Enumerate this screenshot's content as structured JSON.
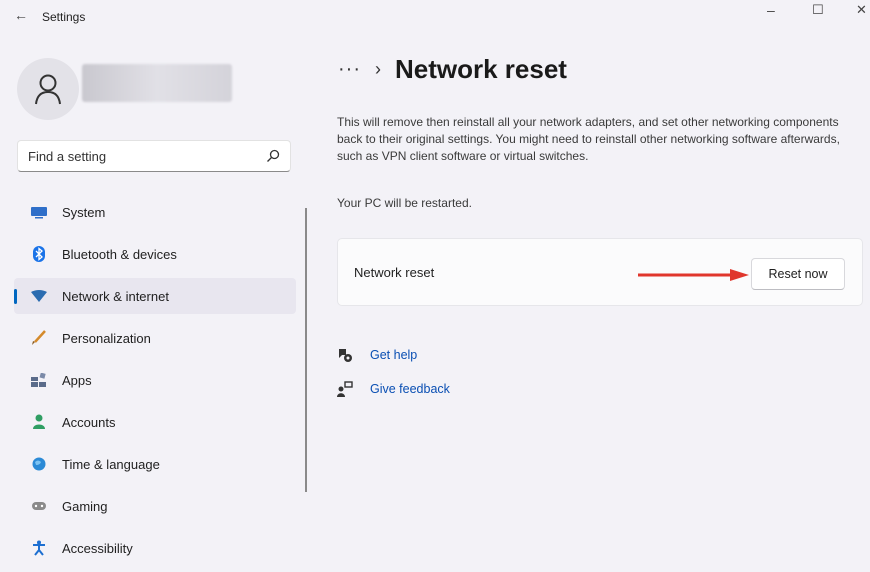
{
  "window": {
    "title": "Settings",
    "back_icon": "back-arrow-icon",
    "minimize": "–",
    "maximize": "☐",
    "close": "✕"
  },
  "user": {
    "avatar_icon": "person-icon",
    "name": ""
  },
  "search": {
    "placeholder": "Find a setting",
    "icon": "search-icon"
  },
  "nav": [
    {
      "label": "System",
      "icon": "system-icon",
      "color": "#2f6fc9",
      "active": false
    },
    {
      "label": "Bluetooth & devices",
      "icon": "bluetooth-icon",
      "color": "#1a73e8",
      "active": false
    },
    {
      "label": "Network & internet",
      "icon": "wifi-icon",
      "color": "#2b6cb0",
      "active": true
    },
    {
      "label": "Personalization",
      "icon": "brush-icon",
      "color": "#d48a2b",
      "active": false
    },
    {
      "label": "Apps",
      "icon": "apps-icon",
      "color": "#5a6b8a",
      "active": false
    },
    {
      "label": "Accounts",
      "icon": "accounts-icon",
      "color": "#2f9e63",
      "active": false
    },
    {
      "label": "Time & language",
      "icon": "globe-clock-icon",
      "color": "#2b8ad6",
      "active": false
    },
    {
      "label": "Gaming",
      "icon": "gamepad-icon",
      "color": "#8a8a8a",
      "active": false
    },
    {
      "label": "Accessibility",
      "icon": "accessibility-icon",
      "color": "#1c6fd1",
      "active": false
    }
  ],
  "main": {
    "breadcrumb_more": "···",
    "breadcrumb_sep": "›",
    "title": "Network reset",
    "description": "This will remove then reinstall all your network adapters, and set other networking components back to their original settings. You might need to reinstall other networking software afterwards, such as VPN client software or virtual switches.",
    "restart_note": "Your PC will be restarted.",
    "card": {
      "label": "Network reset",
      "button": "Reset now",
      "annotation_arrow_color": "#e0362c"
    },
    "links": [
      {
        "label": "Get help",
        "icon": "help-icon"
      },
      {
        "label": "Give feedback",
        "icon": "feedback-icon"
      }
    ]
  },
  "colors": {
    "accent": "#0067c0",
    "background": "#f3f2f7",
    "link": "#0a4fb3"
  }
}
